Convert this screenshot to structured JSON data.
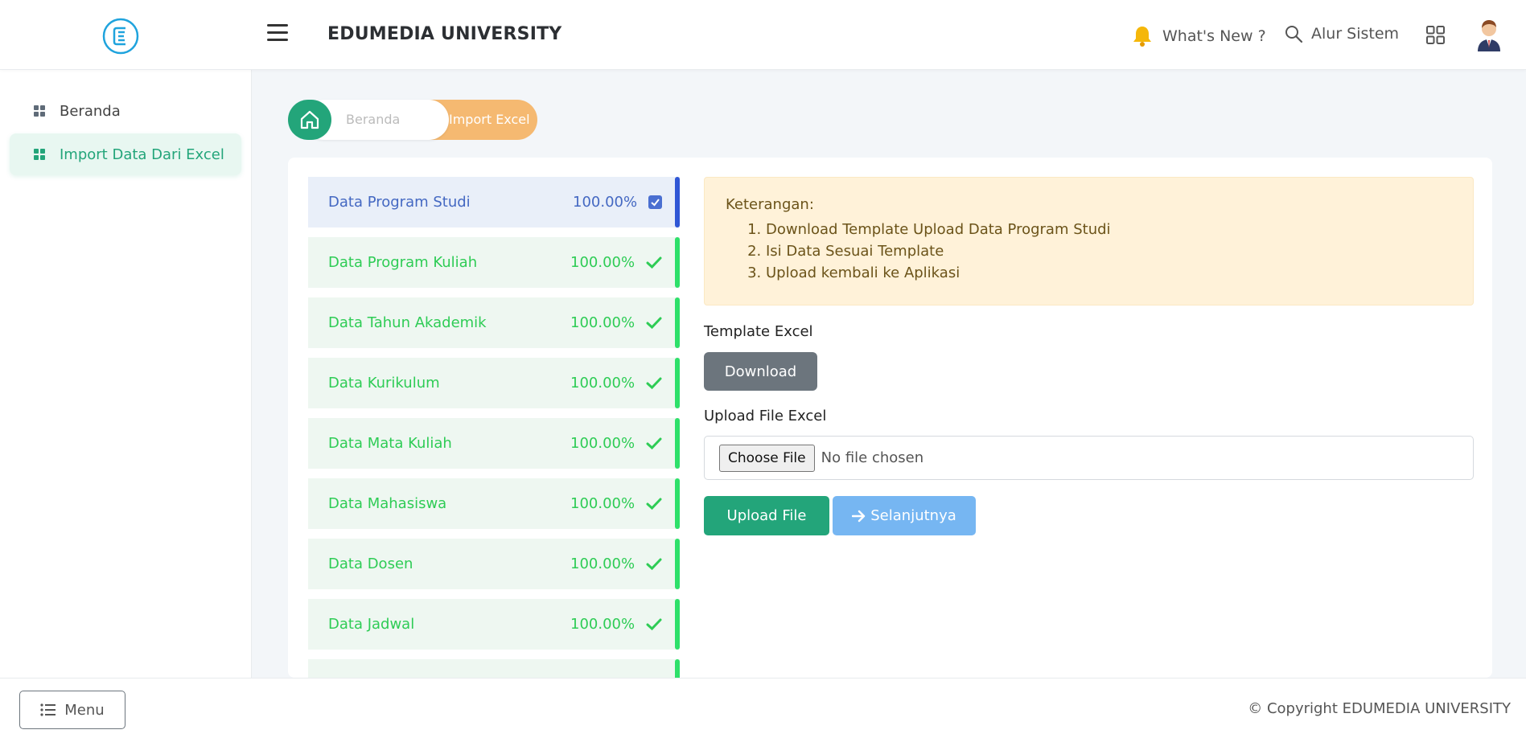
{
  "header": {
    "brand": "EDUMEDIA UNIVERSITY",
    "whats_new": "What's New ?",
    "alur_sistem": "Alur Sistem"
  },
  "sidebar": {
    "items": [
      {
        "label": "Beranda",
        "active": false
      },
      {
        "label": "Import Data Dari Excel",
        "active": true
      }
    ]
  },
  "breadcrumb": {
    "home": "Beranda",
    "current": "Import Excel"
  },
  "steps": [
    {
      "label": "Data Program Studi",
      "progress": "100.00%",
      "active": true
    },
    {
      "label": "Data Program Kuliah",
      "progress": "100.00%",
      "active": false
    },
    {
      "label": "Data Tahun Akademik",
      "progress": "100.00%",
      "active": false
    },
    {
      "label": "Data Kurikulum",
      "progress": "100.00%",
      "active": false
    },
    {
      "label": "Data Mata Kuliah",
      "progress": "100.00%",
      "active": false
    },
    {
      "label": "Data Mahasiswa",
      "progress": "100.00%",
      "active": false
    },
    {
      "label": "Data Dosen",
      "progress": "100.00%",
      "active": false
    },
    {
      "label": "Data Jadwal",
      "progress": "100.00%",
      "active": false
    }
  ],
  "info": {
    "title": "Keterangan:",
    "items": [
      "Download Template Upload Data Program Studi",
      "Isi Data Sesuai Template",
      "Upload kembali ke Aplikasi"
    ]
  },
  "form": {
    "template_label": "Template Excel",
    "download_label": "Download",
    "upload_label": "Upload File Excel",
    "choose_file": "Choose File",
    "no_file": "No file chosen",
    "upload_button": "Upload File",
    "next_button": "Selanjutnya"
  },
  "footer": {
    "menu": "Menu",
    "copyright": "© Copyright EDUMEDIA UNIVERSITY"
  },
  "colors": {
    "primary": "#23a57a",
    "active_step": "#4468c2",
    "done_step": "#2ecc55",
    "breadcrumb_current": "#f5b971",
    "info_bg": "#fff2d9"
  }
}
